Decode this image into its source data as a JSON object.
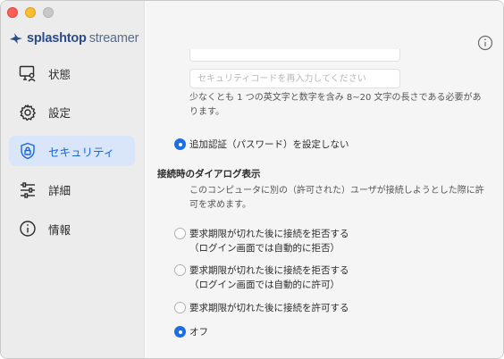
{
  "brand": {
    "name_bold": "splashtop",
    "name_light": "streamer",
    "accent": "#1c6fe3"
  },
  "window_controls": [
    "close",
    "minimize",
    "maximize"
  ],
  "sidebar": {
    "items": [
      {
        "label": "状態",
        "icon": "monitor-person-icon",
        "active": false
      },
      {
        "label": "設定",
        "icon": "gear-icon",
        "active": false
      },
      {
        "label": "セキュリティ",
        "icon": "shield-lock-icon",
        "active": true
      },
      {
        "label": "詳細",
        "icon": "sliders-icon",
        "active": false
      },
      {
        "label": "情報",
        "icon": "info-icon",
        "active": false
      }
    ]
  },
  "security": {
    "reenter_placeholder": "セキュリティコードを再入力してください",
    "password_hint": "少なくとも 1 つの英文字と数字を含み 8~20 文字の長さである必要があります。",
    "no_additional_auth": "追加認証（パスワード）を設定しない",
    "dialog_title": "接続時のダイアログ表示",
    "dialog_description": "このコンピュータに別の（許可された）ユーザが接続しようとした際に許可を求めます。",
    "options": [
      {
        "line1": "要求期限が切れた後に接続を拒否する",
        "line2": "（ログイン画面では自動的に拒否）",
        "checked": false
      },
      {
        "line1": "要求期限が切れた後に接続を拒否する",
        "line2": "（ログイン画面では自動的に許可）",
        "checked": false
      },
      {
        "line1": "要求期限が切れた後に接続を許可する",
        "line2": "",
        "checked": false
      },
      {
        "line1": "オフ",
        "line2": "",
        "checked": true
      }
    ]
  }
}
